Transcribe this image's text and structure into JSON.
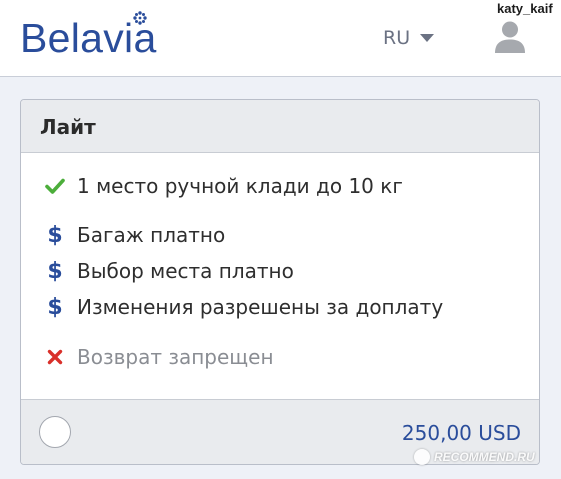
{
  "header": {
    "logo_text": "Belavia",
    "language": "RU",
    "username": "katy_kaif"
  },
  "fare": {
    "title": "Лайт",
    "features": [
      {
        "icon": "check-icon",
        "text": "1 место ручной клади до 10 кг",
        "status": "included"
      },
      {
        "icon": "dollar-icon",
        "text": "Багаж платно",
        "status": "paid"
      },
      {
        "icon": "dollar-icon",
        "text": "Выбор места платно",
        "status": "paid"
      },
      {
        "icon": "dollar-icon",
        "text": "Изменения разрешены за доплату",
        "status": "paid"
      },
      {
        "icon": "cross-icon",
        "text": "Возврат запрещен",
        "status": "not-included"
      }
    ],
    "price": "250,00 USD",
    "selected": false
  },
  "watermark": {
    "text": "RECOMMEND.RU"
  },
  "colors": {
    "brand_blue": "#2a4d9b",
    "check_green": "#4cae3b",
    "cross_red": "#d9302a",
    "page_background": "#eef1f7"
  }
}
